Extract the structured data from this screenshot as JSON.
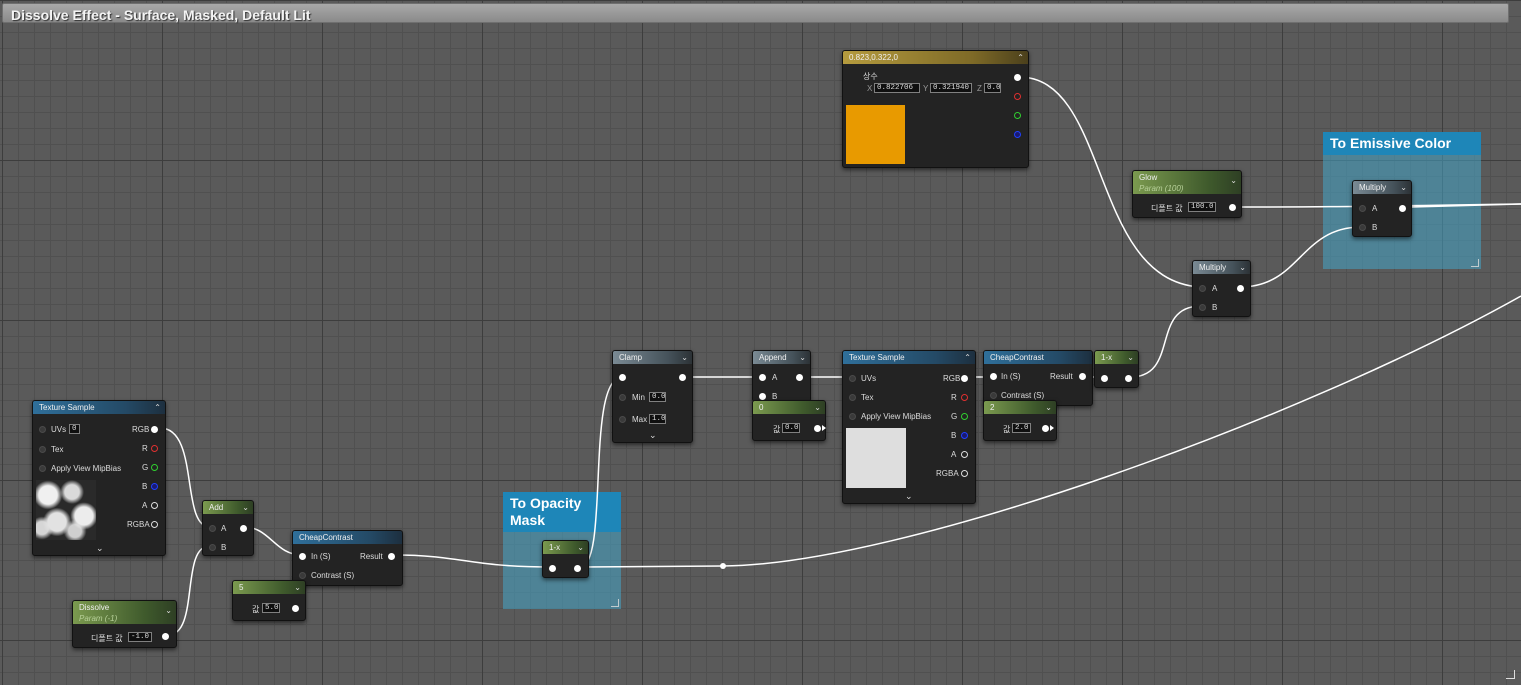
{
  "window": {
    "title": "Dissolve Effect - Surface, Masked, Default Lit"
  },
  "comments": {
    "opacity": "To Opacity Mask",
    "emissive": "To Emissive Color"
  },
  "constant3": {
    "header": "0.823,0.322,0",
    "name": "상수",
    "x_label": "X",
    "x_value": "0.822706",
    "y_label": "Y",
    "y_value": "0.321940",
    "z_label": "Z",
    "z_value": "0.0",
    "swatch_color": "#E89A00"
  },
  "glow": {
    "title": "Glow",
    "subtitle": "Param (100)",
    "default_label": "디폴트 값",
    "default_value": "100.0"
  },
  "multiply_emissive": {
    "title": "Multiply",
    "pin_a": "A",
    "pin_b": "B"
  },
  "multiply_color": {
    "title": "Multiply",
    "pin_a": "A",
    "pin_b": "B"
  },
  "clamp": {
    "title": "Clamp",
    "min_label": "Min",
    "min_value": "0.0",
    "max_label": "Max",
    "max_value": "1.0"
  },
  "append": {
    "title": "Append",
    "pin_a": "A",
    "pin_b": "B"
  },
  "const_zero": {
    "title": "0",
    "value_label": "값",
    "value": "0.0"
  },
  "texture_sample_top": {
    "title": "Texture Sample",
    "uvs": "UVs",
    "tex": "Tex",
    "mip": "Apply View MipBias",
    "rgb": "RGB",
    "r": "R",
    "g": "G",
    "b": "B",
    "a": "A",
    "rgba": "RGBA",
    "preview_color": "#DEDEDE"
  },
  "cheap_contrast_top": {
    "title": "CheapContrast",
    "in": "In (S)",
    "result": "Result",
    "contrast": "Contrast (S)"
  },
  "const_two": {
    "title": "2",
    "value_label": "값",
    "value": "2.0"
  },
  "one_minus_top": {
    "title": "1-x"
  },
  "texture_sample_left": {
    "title": "Texture Sample",
    "uvs": "UVs",
    "uvs_value": "0",
    "tex": "Tex",
    "mip": "Apply View MipBias",
    "rgb": "RGB",
    "r": "R",
    "g": "G",
    "b": "B",
    "a": "A",
    "rgba": "RGBA"
  },
  "add": {
    "title": "Add",
    "pin_a": "A",
    "pin_b": "B"
  },
  "dissolve": {
    "title": "Dissolve",
    "subtitle": "Param (-1)",
    "default_label": "디폴트 값",
    "default_value": "-1.0"
  },
  "cheap_contrast_bottom": {
    "title": "CheapContrast",
    "in": "In (S)",
    "result": "Result",
    "contrast": "Contrast (S)"
  },
  "const_five": {
    "title": "5",
    "value_label": "값",
    "value": "5.0"
  },
  "one_minus_mask": {
    "title": "1-x"
  }
}
